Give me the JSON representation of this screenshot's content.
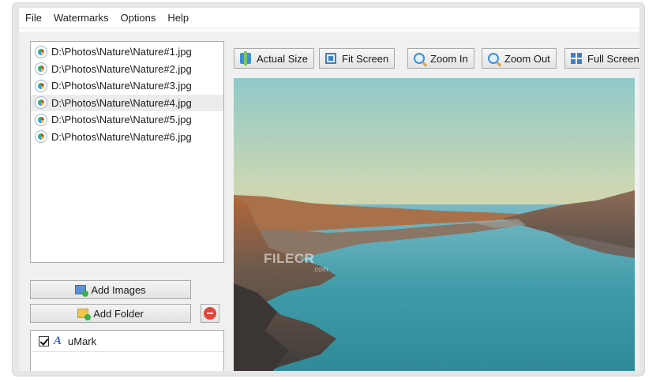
{
  "menu": [
    "File",
    "Watermarks",
    "Options",
    "Help"
  ],
  "files": [
    {
      "path": "D:\\Photos\\Nature\\Nature#1.jpg",
      "selected": false
    },
    {
      "path": "D:\\Photos\\Nature\\Nature#2.jpg",
      "selected": false
    },
    {
      "path": "D:\\Photos\\Nature\\Nature#3.jpg",
      "selected": false
    },
    {
      "path": "D:\\Photos\\Nature\\Nature#4.jpg",
      "selected": true
    },
    {
      "path": "D:\\Photos\\Nature\\Nature#5.jpg",
      "selected": false
    },
    {
      "path": "D:\\Photos\\Nature\\Nature#6.jpg",
      "selected": false
    }
  ],
  "buttons": {
    "add_images": "Add Images",
    "add_folder": "Add Folder"
  },
  "watermarks": [
    {
      "name": "uMark",
      "checked": true
    }
  ],
  "toolbar": {
    "actual_size": "Actual Size",
    "fit_screen": "Fit Screen",
    "zoom_in": "Zoom In",
    "zoom_out": "Zoom Out",
    "full_screen": "Full Screen"
  },
  "overlay": {
    "brand": "FILECR",
    "brand_sub": ".com"
  },
  "colors": {
    "accent": "#3f8fd8",
    "remove": "#e0463a"
  }
}
